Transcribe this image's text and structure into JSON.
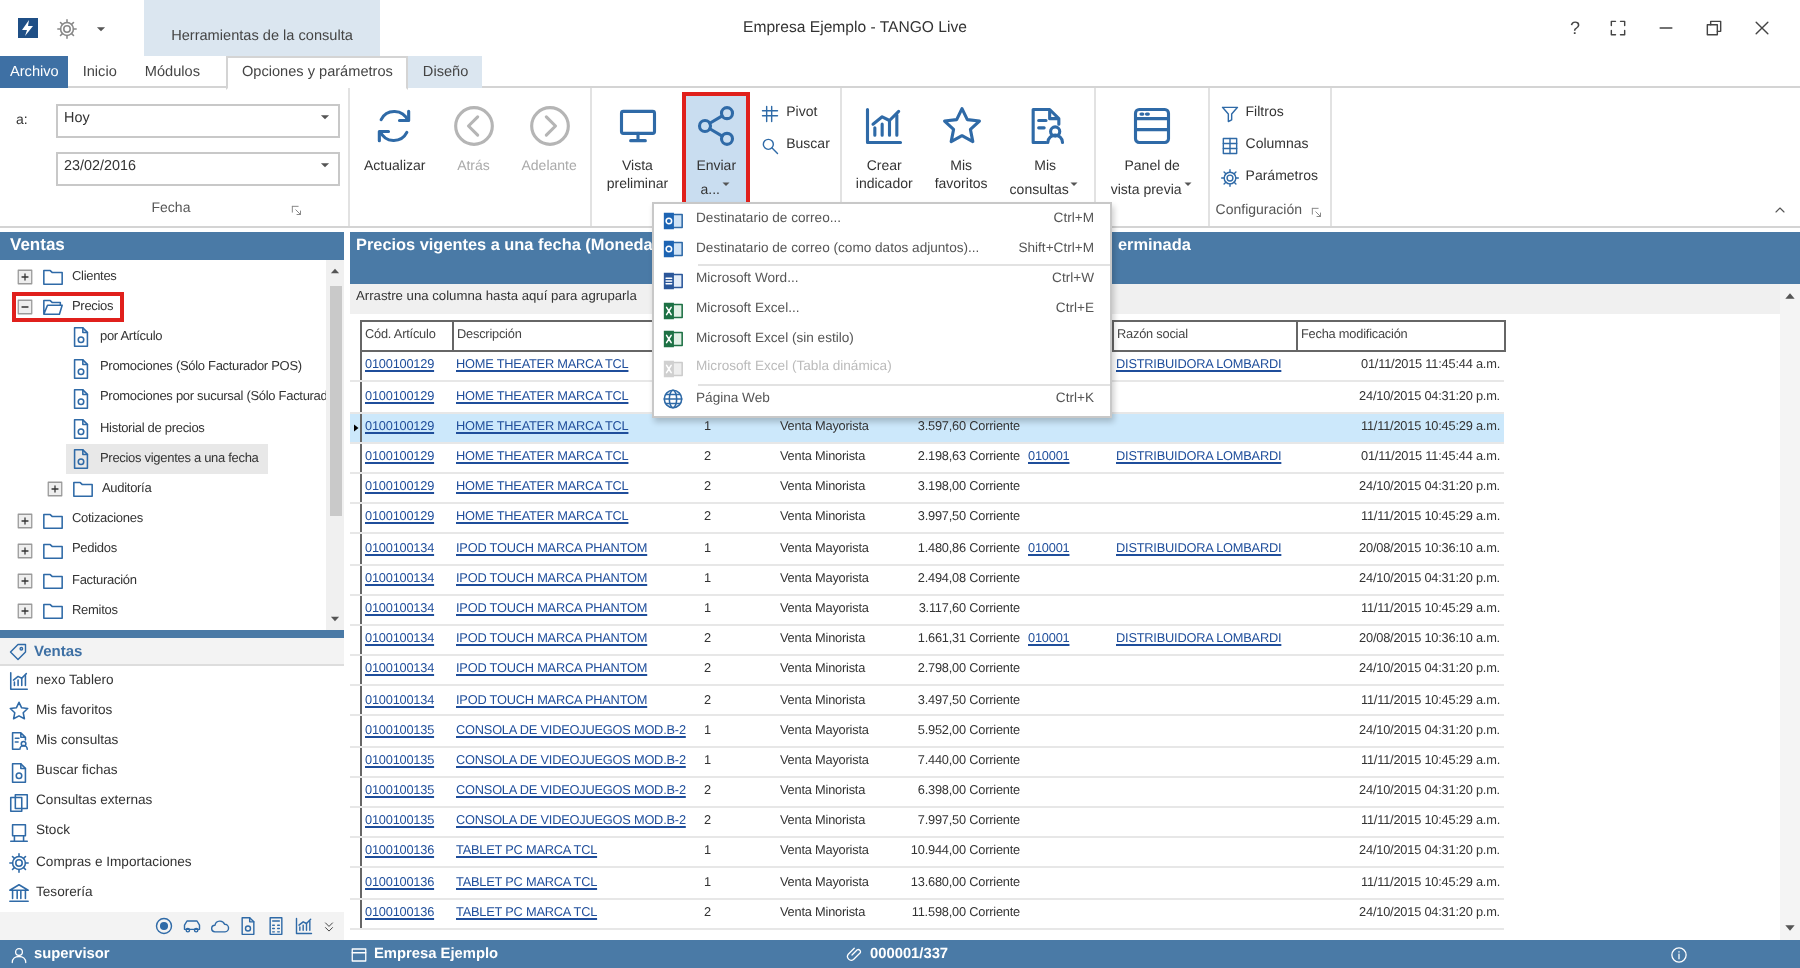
{
  "title_bar": {
    "title": "Empresa Ejemplo - TANGO  Live",
    "context_group": "Herramientas de la consulta",
    "help": "?"
  },
  "ribbon_tabs": [
    {
      "label": "Archivo",
      "kind": "file",
      "selected": false
    },
    {
      "label": "Inicio",
      "kind": "tab",
      "selected": false
    },
    {
      "label": "Módulos",
      "kind": "tab",
      "selected": false
    },
    {
      "label": "Opciones y parámetros",
      "kind": "tab",
      "selected": true
    },
    {
      "label": "Diseño",
      "kind": "context",
      "selected": false
    }
  ],
  "fecha_group": {
    "field_label": "a:",
    "period": "Hoy",
    "date": "23/02/2016",
    "title": "Fecha"
  },
  "ribbon_groups": [
    {
      "buttons": [
        {
          "kind": "refresh",
          "small": false,
          "label": "Actualizar",
          "disabled": false,
          "pressed": false,
          "dropdown": false,
          "highlighted": false
        },
        {
          "kind": "back",
          "small": false,
          "label": "Atrás",
          "disabled": true,
          "pressed": false,
          "dropdown": false,
          "highlighted": false
        },
        {
          "kind": "forward",
          "small": false,
          "label": "Adelante",
          "disabled": true,
          "pressed": false,
          "dropdown": false,
          "highlighted": false
        }
      ]
    },
    {
      "buttons": [
        {
          "kind": "monitor",
          "small": false,
          "label": "Vista\npreliminar",
          "disabled": false,
          "pressed": false,
          "dropdown": false,
          "highlighted": false
        },
        {
          "kind": "share",
          "small": false,
          "label": "Enviar\na...",
          "disabled": false,
          "pressed": true,
          "dropdown": true,
          "highlighted": true
        },
        {
          "kind": "grid",
          "small": true,
          "label": "Pivot",
          "disabled": false
        },
        {
          "kind": "search",
          "small": true,
          "label": "Buscar",
          "disabled": false
        }
      ]
    },
    {
      "buttons": [
        {
          "kind": "chart",
          "small": false,
          "label": "Crear\nindicador",
          "disabled": false,
          "pressed": false,
          "dropdown": false,
          "highlighted": false
        },
        {
          "kind": "star",
          "small": false,
          "label": "Mis\nfavoritos",
          "disabled": false,
          "pressed": false,
          "dropdown": false,
          "highlighted": false
        },
        {
          "kind": "queries",
          "small": false,
          "label": "Mis\nconsultas",
          "disabled": false,
          "pressed": false,
          "dropdown": true,
          "highlighted": false
        }
      ]
    },
    {
      "buttons": [
        {
          "kind": "panel",
          "small": false,
          "label": "Panel de\nvista previa",
          "disabled": false,
          "pressed": false,
          "dropdown": true,
          "highlighted": false
        }
      ]
    },
    {
      "title": "Configuración",
      "buttons": [
        {
          "kind": "filter",
          "small": true,
          "label": "Filtros",
          "disabled": false
        },
        {
          "kind": "columns",
          "small": true,
          "label": "Columnas",
          "disabled": false
        },
        {
          "kind": "gear",
          "small": true,
          "label": "Parámetros",
          "disabled": false
        }
      ]
    }
  ],
  "send_menu": [
    {
      "kind": "mail",
      "label": "Destinatario de correo...",
      "shortcut": "Ctrl+M",
      "disabled": false
    },
    {
      "kind": "mail",
      "label": "Destinatario de correo (como datos adjuntos)...",
      "shortcut": "Shift+Ctrl+M",
      "disabled": false
    },
    {
      "kind": "separator"
    },
    {
      "kind": "word",
      "label": "Microsoft Word...",
      "shortcut": "Ctrl+W",
      "disabled": false
    },
    {
      "kind": "excel",
      "label": "Microsoft Excel...",
      "shortcut": "Ctrl+E",
      "disabled": false
    },
    {
      "kind": "excel",
      "label": "Microsoft Excel (sin estilo)",
      "disabled": false
    },
    {
      "kind": "excel",
      "label": "Microsoft Excel (Tabla dinámica)",
      "disabled": true
    },
    {
      "kind": "separator"
    },
    {
      "kind": "globe",
      "label": "Página Web",
      "shortcut": "Ctrl+K",
      "disabled": false
    }
  ],
  "tree": {
    "title": "Ventas",
    "items": [
      {
        "kind": "folder",
        "label": "Clientes",
        "expanded": false,
        "selected": false,
        "highlighted": false
      },
      {
        "kind": "folder",
        "label": "Precios",
        "expanded": true,
        "selected": false,
        "highlighted": true,
        "children": [
          {
            "kind": "query",
            "label": "por Artículo",
            "selected": false,
            "highlighted": false
          },
          {
            "kind": "query",
            "label": "Promociones (Sólo Facturador POS)",
            "selected": false,
            "highlighted": false
          },
          {
            "kind": "query",
            "label": "Promociones por sucursal (Sólo Facturad",
            "selected": false,
            "highlighted": false
          },
          {
            "kind": "query",
            "label": "Historial de precios",
            "selected": false,
            "highlighted": false
          },
          {
            "kind": "query",
            "label": "Precios vigentes a una fecha",
            "selected": true,
            "highlighted": false
          },
          {
            "kind": "folder",
            "label": "Auditoría",
            "expanded": false,
            "selected": false,
            "highlighted": false
          }
        ]
      },
      {
        "kind": "folder",
        "label": "Cotizaciones",
        "expanded": false,
        "selected": false,
        "highlighted": false
      },
      {
        "kind": "folder",
        "label": "Pedidos",
        "expanded": false,
        "selected": false,
        "highlighted": false
      },
      {
        "kind": "folder",
        "label": "Facturación",
        "expanded": false,
        "selected": false,
        "highlighted": false
      },
      {
        "kind": "folder",
        "label": "Remitos",
        "expanded": false,
        "selected": false,
        "highlighted": false
      }
    ]
  },
  "nav": {
    "title": "Ventas",
    "items": [
      {
        "kind": "chart",
        "label": "nexo Tablero"
      },
      {
        "kind": "star",
        "label": "Mis favoritos"
      },
      {
        "kind": "queries",
        "label": "Mis consultas"
      },
      {
        "kind": "query",
        "label": "Buscar fichas"
      },
      {
        "kind": "docs",
        "label": "Consultas externas"
      },
      {
        "kind": "stand",
        "label": "Stock"
      },
      {
        "kind": "gear",
        "label": "Compras e Importaciones"
      },
      {
        "kind": "bank",
        "label": "Tesorería"
      }
    ]
  },
  "grid": {
    "title_start": "Precios vigentes a una fecha (Moneda",
    "title_end": "erminada",
    "group_hint": "Arrastre una columna hasta aquí para agruparla",
    "columns": [
      "Cód. Artículo",
      "Descripción",
      "Razón social",
      "Fecha modificación"
    ],
    "rows": [
      {
        "selected": false,
        "code": "0100100129",
        "description": "HOME THEATER MARCA TCL",
        "company": "DISTRIBUIDORA LOMBARDI",
        "modified": "01/11/2015 11:45:44 a.m."
      },
      {
        "selected": false,
        "code": "0100100129",
        "description": "HOME THEATER MARCA TCL",
        "modified": "24/10/2015 04:31:20 p.m."
      },
      {
        "selected": true,
        "code": "0100100129",
        "description": "HOME THEATER MARCA TCL",
        "column_3": "1",
        "column_4": "Venta Mayorista",
        "column_5": "3.597,60 Corriente",
        "modified": "11/11/2015 10:45:29 a.m."
      },
      {
        "selected": false,
        "code": "0100100129",
        "description": "HOME THEATER MARCA TCL",
        "column_3": "2",
        "column_4": "Venta Minorista",
        "column_5": "2.198,63 Corriente",
        "column_6": "010001",
        "company": "DISTRIBUIDORA LOMBARDI",
        "modified": "01/11/2015 11:45:44 a.m."
      },
      {
        "selected": false,
        "code": "0100100129",
        "description": "HOME THEATER MARCA TCL",
        "column_3": "2",
        "column_4": "Venta Minorista",
        "column_5": "3.198,00 Corriente",
        "modified": "24/10/2015 04:31:20 p.m."
      },
      {
        "selected": false,
        "code": "0100100129",
        "description": "HOME THEATER MARCA TCL",
        "column_3": "2",
        "column_4": "Venta Minorista",
        "column_5": "3.997,50 Corriente",
        "modified": "11/11/2015 10:45:29 a.m."
      },
      {
        "selected": false,
        "code": "0100100134",
        "description": "IPOD TOUCH MARCA PHANTOM",
        "column_3": "1",
        "column_4": "Venta Mayorista",
        "column_5": "1.480,86 Corriente",
        "column_6": "010001",
        "company": "DISTRIBUIDORA LOMBARDI",
        "modified": "20/08/2015 10:36:10 a.m."
      },
      {
        "selected": false,
        "code": "0100100134",
        "description": "IPOD TOUCH MARCA PHANTOM",
        "column_3": "1",
        "column_4": "Venta Mayorista",
        "column_5": "2.494,08 Corriente",
        "modified": "24/10/2015 04:31:20 p.m."
      },
      {
        "selected": false,
        "code": "0100100134",
        "description": "IPOD TOUCH MARCA PHANTOM",
        "column_3": "1",
        "column_4": "Venta Mayorista",
        "column_5": "3.117,60 Corriente",
        "modified": "11/11/2015 10:45:29 a.m."
      },
      {
        "selected": false,
        "code": "0100100134",
        "description": "IPOD TOUCH MARCA PHANTOM",
        "column_3": "2",
        "column_4": "Venta Minorista",
        "column_5": "1.661,31 Corriente",
        "column_6": "010001",
        "company": "DISTRIBUIDORA LOMBARDI",
        "modified": "20/08/2015 10:36:10 a.m."
      },
      {
        "selected": false,
        "code": "0100100134",
        "description": "IPOD TOUCH MARCA PHANTOM",
        "column_3": "2",
        "column_4": "Venta Minorista",
        "column_5": "2.798,00 Corriente",
        "modified": "24/10/2015 04:31:20 p.m."
      },
      {
        "selected": false,
        "code": "0100100134",
        "description": "IPOD TOUCH MARCA PHANTOM",
        "column_3": "2",
        "column_4": "Venta Minorista",
        "column_5": "3.497,50 Corriente",
        "modified": "11/11/2015 10:45:29 a.m."
      },
      {
        "selected": false,
        "code": "0100100135",
        "description": "CONSOLA DE VIDEOJUEGOS MOD.B-2",
        "column_3": "1",
        "column_4": "Venta Mayorista",
        "column_5": "5.952,00 Corriente",
        "modified": "24/10/2015 04:31:20 p.m."
      },
      {
        "selected": false,
        "code": "0100100135",
        "description": "CONSOLA DE VIDEOJUEGOS MOD.B-2",
        "column_3": "1",
        "column_4": "Venta Mayorista",
        "column_5": "7.440,00 Corriente",
        "modified": "11/11/2015 10:45:29 a.m."
      },
      {
        "selected": false,
        "code": "0100100135",
        "description": "CONSOLA DE VIDEOJUEGOS MOD.B-2",
        "column_3": "2",
        "column_4": "Venta Minorista",
        "column_5": "6.398,00 Corriente",
        "modified": "24/10/2015 04:31:20 p.m."
      },
      {
        "selected": false,
        "code": "0100100135",
        "description": "CONSOLA DE VIDEOJUEGOS MOD.B-2",
        "column_3": "2",
        "column_4": "Venta Minorista",
        "column_5": "7.997,50 Corriente",
        "modified": "11/11/2015 10:45:29 a.m."
      },
      {
        "selected": false,
        "code": "0100100136",
        "description": "TABLET PC  MARCA TCL",
        "column_3": "1",
        "column_4": "Venta Mayorista",
        "column_5": "10.944,00 Corriente",
        "modified": "24/10/2015 04:31:20 p.m."
      },
      {
        "selected": false,
        "code": "0100100136",
        "description": "TABLET PC  MARCA TCL",
        "column_3": "1",
        "column_4": "Venta Mayorista",
        "column_5": "13.680,00 Corriente",
        "modified": "11/11/2015 10:45:29 a.m."
      },
      {
        "selected": false,
        "code": "0100100136",
        "description": "TABLET PC  MARCA TCL",
        "column_3": "2",
        "column_4": "Venta Minorista",
        "column_5": "11.598,00 Corriente",
        "modified": "24/10/2015 04:31:20 p.m."
      }
    ]
  },
  "status_bar": {
    "user": "supervisor",
    "company": "Empresa Ejemplo",
    "record": "000001/337"
  }
}
